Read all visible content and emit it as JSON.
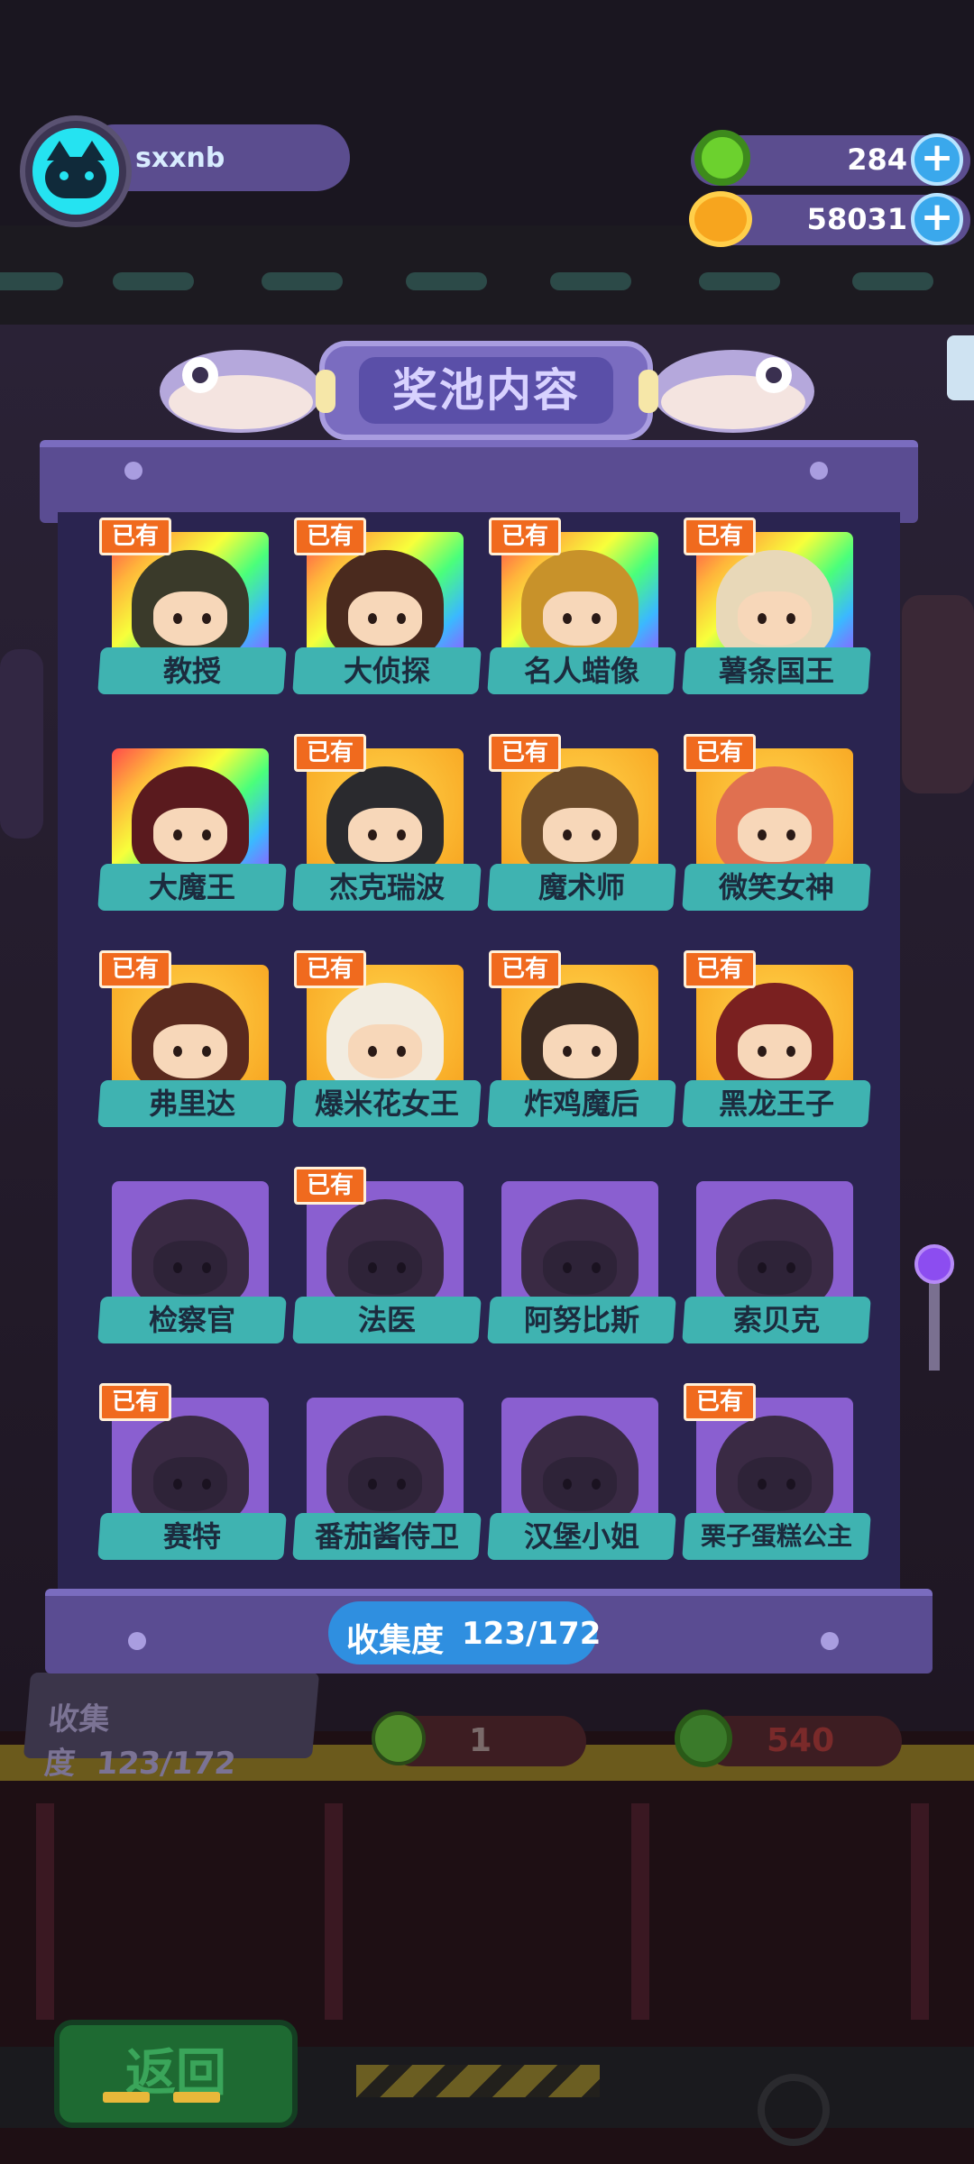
{
  "profile": {
    "username": "sxxnb"
  },
  "resources": {
    "gems": "284",
    "coins": "58031",
    "plus_symbol": "+"
  },
  "panel": {
    "title": "奖池内容",
    "progress_label": "收集度",
    "progress_value": "123/172",
    "owned_badge": "已有"
  },
  "characters": [
    {
      "name": "教授",
      "owned": true,
      "frame": "rainbow"
    },
    {
      "name": "大侦探",
      "owned": true,
      "frame": "rainbow"
    },
    {
      "name": "名人蜡像",
      "owned": true,
      "frame": "rainbow"
    },
    {
      "name": "薯条国王",
      "owned": true,
      "frame": "rainbow"
    },
    {
      "name": "大魔王",
      "owned": false,
      "frame": "rainbow"
    },
    {
      "name": "杰克瑞波",
      "owned": true,
      "frame": "gold"
    },
    {
      "name": "魔术师",
      "owned": true,
      "frame": "gold"
    },
    {
      "name": "微笑女神",
      "owned": true,
      "frame": "gold"
    },
    {
      "name": "弗里达",
      "owned": true,
      "frame": "gold"
    },
    {
      "name": "爆米花女王",
      "owned": true,
      "frame": "gold"
    },
    {
      "name": "炸鸡魔后",
      "owned": true,
      "frame": "gold"
    },
    {
      "name": "黑龙王子",
      "owned": true,
      "frame": "gold"
    },
    {
      "name": "检察官",
      "owned": false,
      "frame": "purple"
    },
    {
      "name": "法医",
      "owned": true,
      "frame": "purple"
    },
    {
      "name": "阿努比斯",
      "owned": false,
      "frame": "purple"
    },
    {
      "name": "索贝克",
      "owned": false,
      "frame": "purple"
    },
    {
      "name": "赛特",
      "owned": true,
      "frame": "purple"
    },
    {
      "name": "番茄酱侍卫",
      "owned": false,
      "frame": "purple"
    },
    {
      "name": "汉堡小姐",
      "owned": false,
      "frame": "purple"
    },
    {
      "name": "栗子蛋糕公主",
      "owned": true,
      "frame": "purple"
    }
  ],
  "background": {
    "collection_label": "收集度",
    "collection_value": "123/172",
    "cost_single": "1",
    "cost_multi": "540",
    "back_label": "返回"
  },
  "colors": {
    "hud_bar": "#5b4d8f",
    "panel": "#2a2450",
    "name_tag": "#3fb3b1",
    "owned_badge": "#f06a1e",
    "progress_pill": "#2f8fe0",
    "avatar": "#25e3f1"
  }
}
